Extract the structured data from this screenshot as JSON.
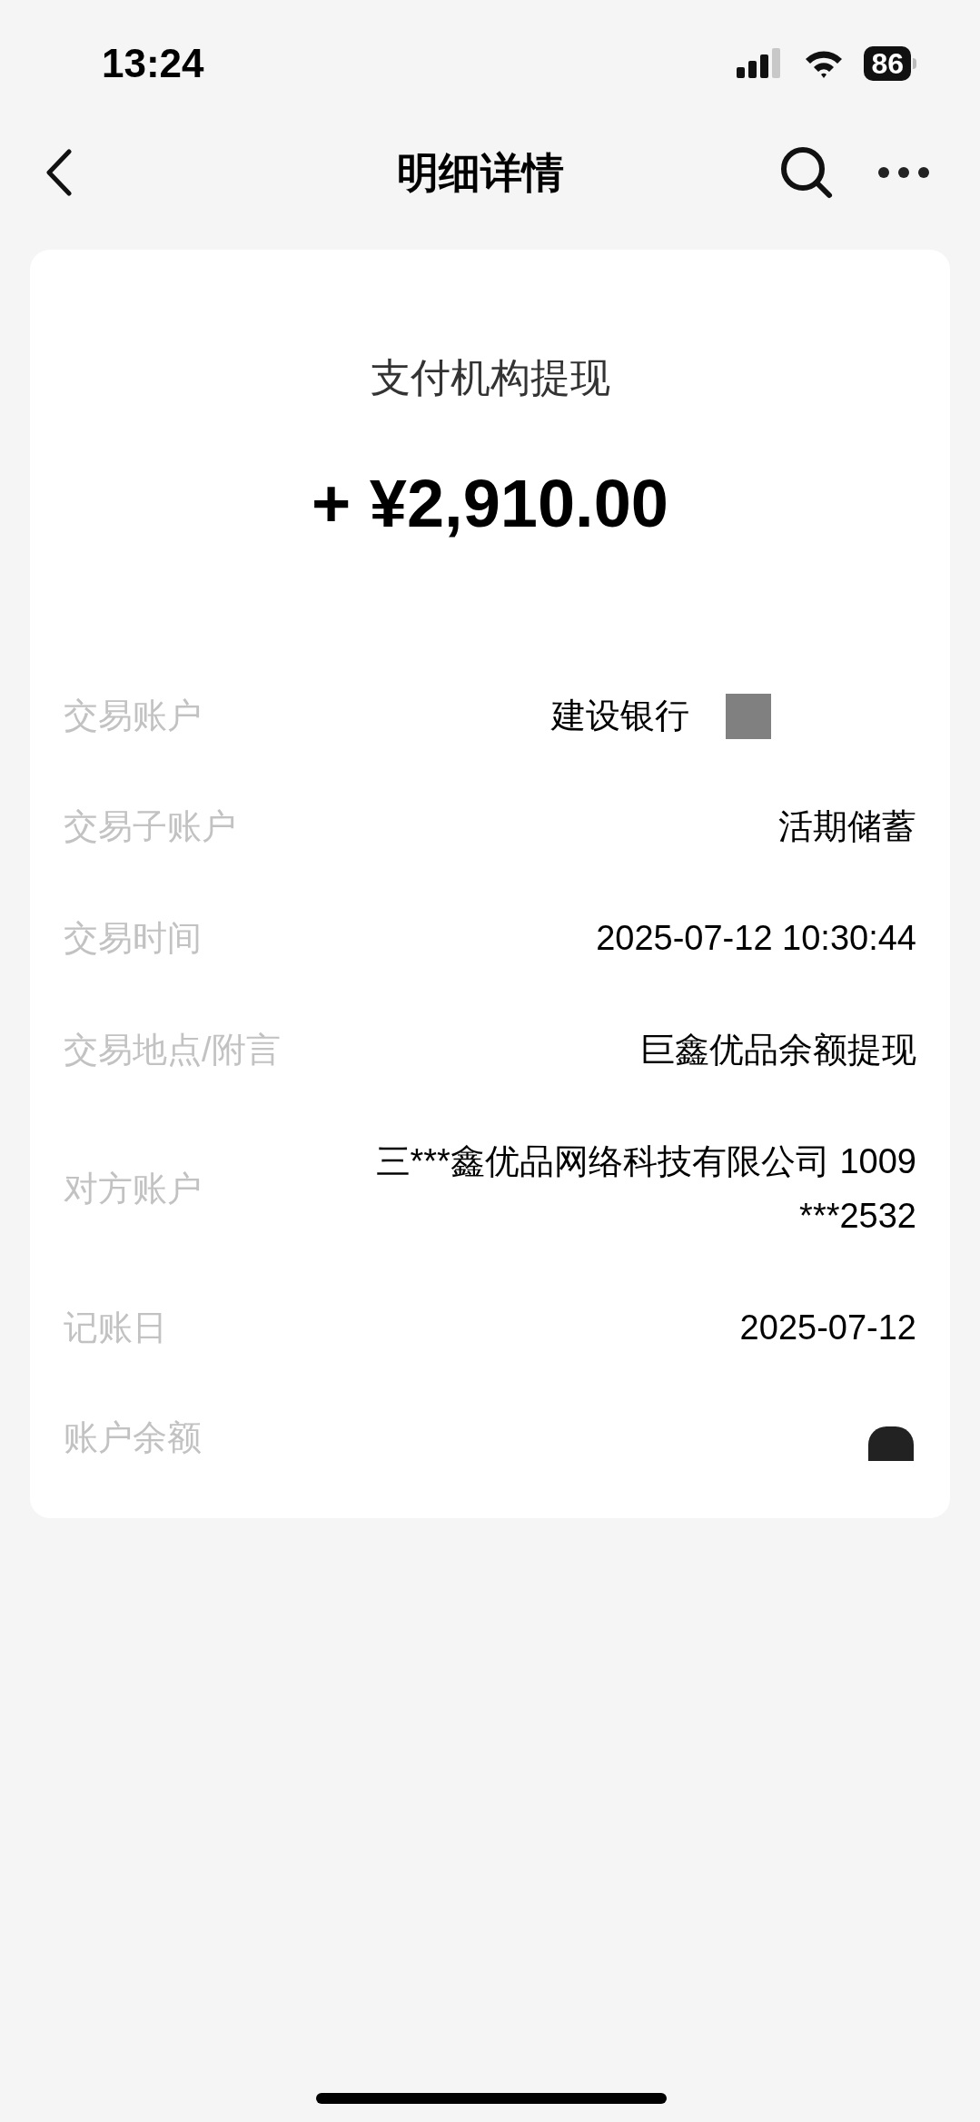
{
  "status_bar": {
    "time": "13:24",
    "battery": "86"
  },
  "nav": {
    "title": "明细详情"
  },
  "summary": {
    "title": "支付机构提现",
    "amount": "+ ¥2,910.00"
  },
  "rows": [
    {
      "label": "交易账户",
      "value": "建设银行",
      "kind": "masked"
    },
    {
      "label": "交易子账户",
      "value": "活期储蓄",
      "kind": "text"
    },
    {
      "label": "交易时间",
      "value": "2025-07-12 10:30:44",
      "kind": "text"
    },
    {
      "label": "交易地点/附言",
      "value": "巨鑫优品余额提现",
      "kind": "text"
    },
    {
      "label": "对方账户",
      "value": "三***鑫优品网络科技有限公司 1009***2532",
      "kind": "text"
    },
    {
      "label": "记账日",
      "value": "2025-07-12",
      "kind": "text"
    },
    {
      "label": "账户余额",
      "kind": "redacted"
    }
  ]
}
